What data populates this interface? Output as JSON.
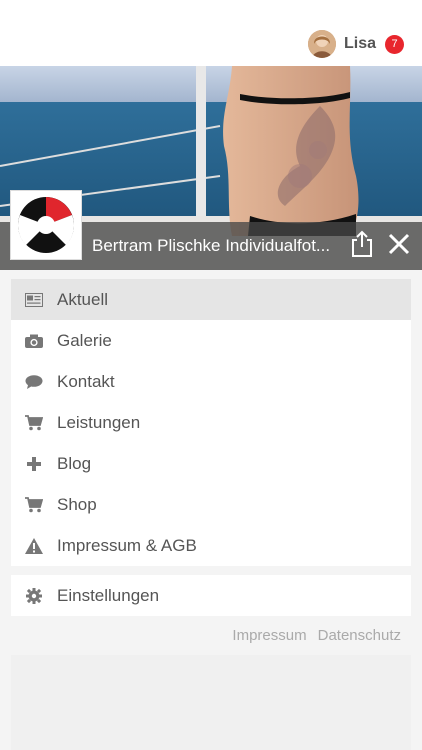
{
  "header": {
    "user_name": "Lisa",
    "notification_count": "7"
  },
  "hero": {
    "title": "Bertram Plischke Individualfot..."
  },
  "menu": {
    "items": [
      {
        "label": "Aktuell"
      },
      {
        "label": "Galerie"
      },
      {
        "label": "Kontakt"
      },
      {
        "label": "Leistungen"
      },
      {
        "label": "Blog"
      },
      {
        "label": "Shop"
      },
      {
        "label": "Impressum & AGB"
      }
    ],
    "settings": {
      "label": "Einstellungen"
    }
  },
  "footer": {
    "impressum": "Impressum",
    "datenschutz": "Datenschutz"
  },
  "colors": {
    "badge": "#e8262d",
    "active_item": "#e5e5e5",
    "icon": "#777777"
  }
}
